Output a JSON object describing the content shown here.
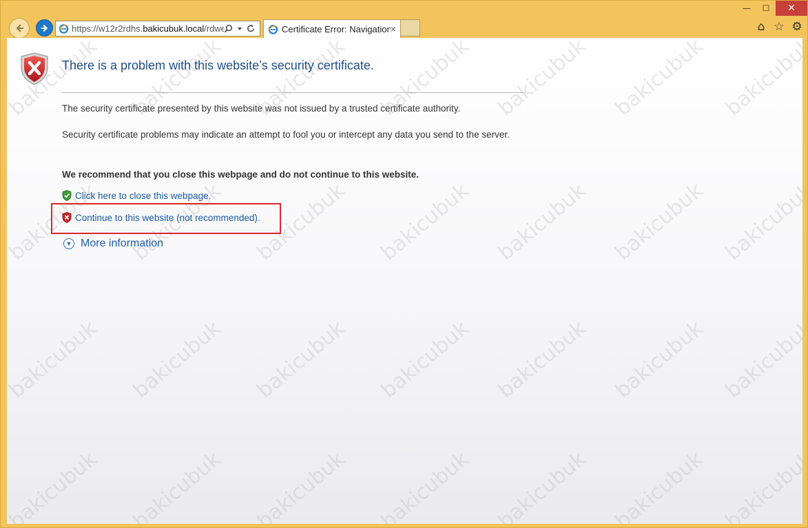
{
  "browser": {
    "address": {
      "url_prefix": "https://w12r2rdhs.",
      "url_domain": "bakicubuk.local",
      "url_suffix": "/rdweb"
    },
    "tab": {
      "title": "Certificate Error: Navigation...",
      "close_glyph": "×"
    },
    "window_controls": {
      "minimize": "—",
      "maximize": "☐",
      "close": "✕"
    },
    "icons": {
      "home": "⌂",
      "favorites": "☆",
      "tools": "⚙"
    }
  },
  "page": {
    "title": "There is a problem with this website’s security certificate.",
    "paragraph1": "The security certificate presented by this website was not issued by a trusted certificate authority.",
    "paragraph2": "Security certificate problems may indicate an attempt to fool you or intercept any data you send to the server.",
    "recommendation": "We recommend that you close this webpage and do not continue to this website.",
    "close_link": "Click here to close this webpage.",
    "continue_link": "Continue to this website (not recommended).",
    "more_info": "More information"
  },
  "watermark_text": "bakicubuk",
  "colors": {
    "frame": "#f3c45b",
    "title_blue": "#1f4e87",
    "link_blue": "#1a5aa0",
    "highlight_red": "#d9262b"
  }
}
